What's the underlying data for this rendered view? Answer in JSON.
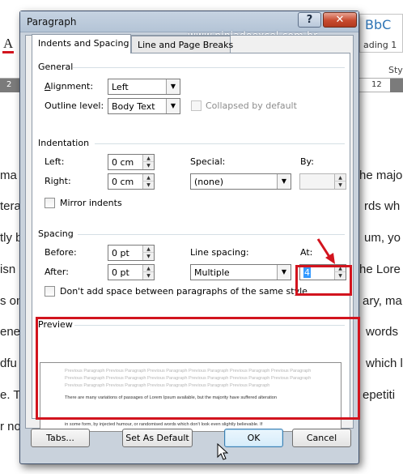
{
  "dialog": {
    "title": "Paragraph",
    "help_button": "?",
    "close_button": "✕",
    "watermark": "www.ninjadoexcel.com.br"
  },
  "tabs": [
    {
      "label": "Indents and Spacing",
      "active": true
    },
    {
      "label": "Line and Page Breaks",
      "active": false
    }
  ],
  "general": {
    "section_label": "General",
    "alignment_label": "Alignment:",
    "alignment_value": "Left",
    "outline_level_label": "Outline level:",
    "outline_level_value": "Body Text",
    "collapsed_label": "Collapsed by default"
  },
  "indentation": {
    "section_label": "Indentation",
    "left_label": "Left:",
    "left_value": "0 cm",
    "right_label": "Right:",
    "right_value": "0 cm",
    "special_label": "Special:",
    "special_value": "(none)",
    "by_label": "By:",
    "by_value": "",
    "mirror_label": "Mirror indents"
  },
  "spacing": {
    "section_label": "Spacing",
    "before_label": "Before:",
    "before_value": "0 pt",
    "after_label": "After:",
    "after_value": "0 pt",
    "line_spacing_label": "Line spacing:",
    "line_spacing_value": "Multiple",
    "at_label": "At:",
    "at_value": "4",
    "dont_add_space_label": "Don't add space between paragraphs of the same style"
  },
  "preview": {
    "section_label": "Preview",
    "previous_lines": [
      "Previous Paragraph Previous Paragraph Previous Paragraph Previous Paragraph Previous Paragraph Previous Paragraph",
      "Previous Paragraph Previous Paragraph Previous Paragraph Previous Paragraph Previous Paragraph Previous Paragraph",
      "Previous Paragraph Previous Paragraph Previous Paragraph Previous Paragraph Previous Paragraph"
    ],
    "sample_line_1": "There are many variations of passages of Lorem Ipsum available, but the majority have suffered alteration",
    "sample_line_2": "in some form, by injected humour, or randomised words which don't look even slightly believable. If"
  },
  "buttons": {
    "tabs": "Tabs...",
    "set_as_default": "Set As Default",
    "ok": "OK",
    "cancel": "Cancel"
  },
  "background": {
    "ribbon_letter": "A",
    "style_sample": "BbC",
    "style_name": "ading 1",
    "styles_group": "Styl",
    "ruler_left": "2",
    "ruler_right": "12",
    "left_fragments": [
      "ma",
      "tera",
      "tly b",
      "isn",
      "s on",
      "ene",
      "dfu",
      "e. T",
      "r no"
    ],
    "right_fragments": [
      "he majo",
      "rds wh",
      "um, yo",
      "he Lore",
      "ary, ma",
      "words",
      "which l",
      "epetiti"
    ]
  },
  "colors": {
    "highlight_red": "#d2141e",
    "title_bar": "#c6d3e2"
  }
}
